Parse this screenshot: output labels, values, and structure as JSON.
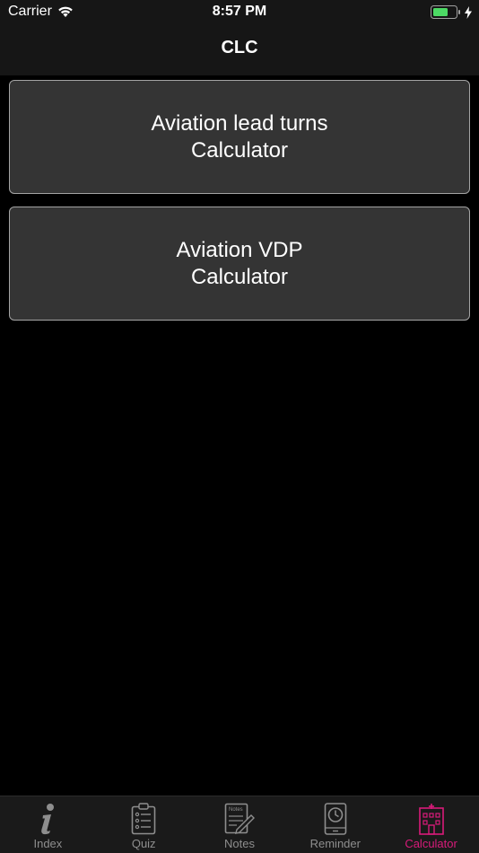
{
  "status_bar": {
    "carrier": "Carrier",
    "time": "8:57 PM",
    "wifi_icon": "wifi-icon",
    "battery_icon": "battery-charging-icon"
  },
  "nav": {
    "title": "CLC"
  },
  "buttons": [
    {
      "line1": "Aviation lead turns",
      "line2": "Calculator"
    },
    {
      "line1": "Aviation VDP",
      "line2": "Calculator"
    }
  ],
  "tabs": [
    {
      "label": "Index",
      "icon": "info-icon"
    },
    {
      "label": "Quiz",
      "icon": "clipboard-icon"
    },
    {
      "label": "Notes",
      "icon": "notes-icon"
    },
    {
      "label": "Reminder",
      "icon": "clock-phone-icon"
    },
    {
      "label": "Calculator",
      "icon": "hospital-icon",
      "active": true
    }
  ],
  "colors": {
    "accent": "#d81b7a",
    "battery": "#4cd964",
    "button_bg": "#343434",
    "button_border": "#a4a4a4",
    "header_bg": "#161616",
    "tab_bar_bg": "#1a1a1a",
    "inactive_tab": "#8e8e8e"
  }
}
